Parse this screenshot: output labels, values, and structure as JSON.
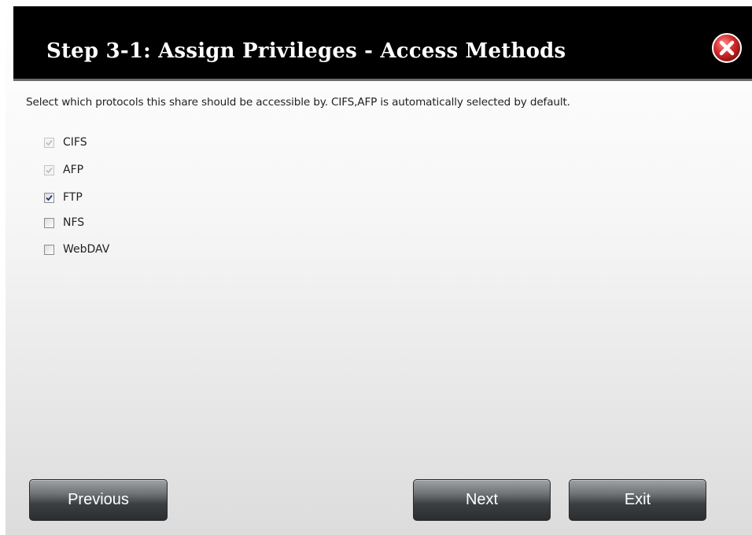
{
  "dialog": {
    "title": "Step 3-1: Assign Privileges - Access Methods",
    "description": "Select which protocols this share should be accessible by. CIFS,AFP is automatically selected by default.",
    "close_icon": "close-icon",
    "colors": {
      "titlebar": "#000000",
      "close_red": "#d42a2a",
      "button": "#3b3f41"
    }
  },
  "protocols": [
    {
      "label": "CIFS",
      "checked": true,
      "disabled": true
    },
    {
      "label": "AFP",
      "checked": true,
      "disabled": true
    },
    {
      "label": "FTP",
      "checked": true,
      "disabled": false
    },
    {
      "label": "NFS",
      "checked": false,
      "disabled": false
    },
    {
      "label": "WebDAV",
      "checked": false,
      "disabled": false
    }
  ],
  "buttons": {
    "previous": "Previous",
    "next": "Next",
    "exit": "Exit"
  }
}
